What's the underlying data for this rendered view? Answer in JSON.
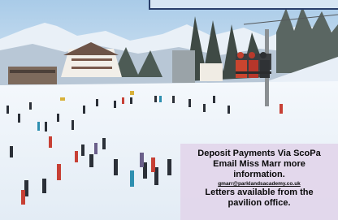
{
  "panel": {
    "line1": "Deposit Payments Via ScoPa",
    "line2": "Email Miss Marr more",
    "line3": "information.",
    "email": "gmarr@parklandsacademy.co.uk",
    "line4": "Letters available from the",
    "line5": "pavilion office."
  },
  "colors": {
    "panel_bg": "#e2d6eb",
    "box_border": "#2a3f6a",
    "snow": "#eef4fa",
    "sky": "#bcd6ec"
  }
}
